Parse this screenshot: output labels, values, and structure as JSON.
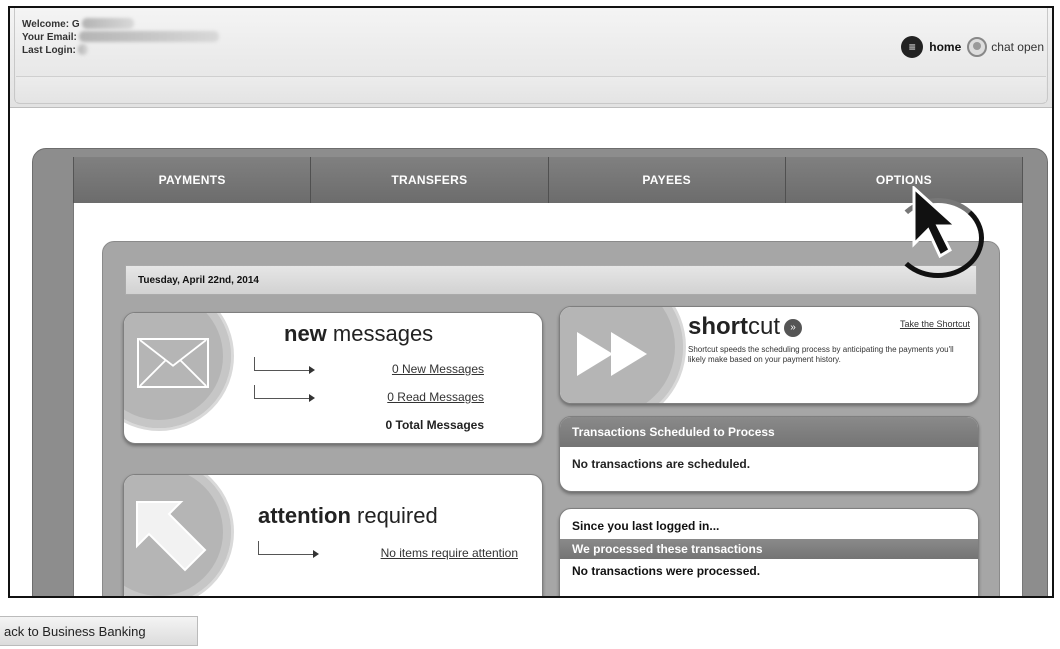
{
  "header": {
    "welcome_label": "Welcome: G",
    "email_label": "Your Email:",
    "last_login_label": "Last Login:",
    "home_label": "home",
    "chat_label": "chat open"
  },
  "nav": {
    "tabs": [
      {
        "label": "PAYMENTS"
      },
      {
        "label": "TRANSFERS"
      },
      {
        "label": "PAYEES"
      },
      {
        "label": "OPTIONS"
      }
    ]
  },
  "date_text": "Tuesday, April 22nd, 2014",
  "messages": {
    "title_bold": "new",
    "title_rest": " messages",
    "new_link": "0 New Messages",
    "read_link": "0 Read Messages",
    "total": "0 Total Messages"
  },
  "attention": {
    "title_bold": "attention",
    "title_rest": " required",
    "link": "No items require attention"
  },
  "shortcut": {
    "title_bold": "short",
    "title_rest": "cut",
    "take_link": "Take the Shortcut",
    "description": "Shortcut speeds the scheduling process by anticipating the payments you'll likely make based on your payment history."
  },
  "scheduled": {
    "heading": "Transactions Scheduled to Process",
    "body": "No transactions are scheduled."
  },
  "since": {
    "title": "Since you last logged in...",
    "subheading": "We processed these transactions",
    "body": "No transactions were processed."
  },
  "footer": {
    "back_label": "ack to Business Banking"
  },
  "icons": {
    "home": "home-icon",
    "chat": "chat-icon",
    "envelope": "envelope-icon",
    "attention_arrow": "arrow-icon",
    "fast_forward": "fast-forward-icon",
    "cursor": "cursor-icon"
  }
}
